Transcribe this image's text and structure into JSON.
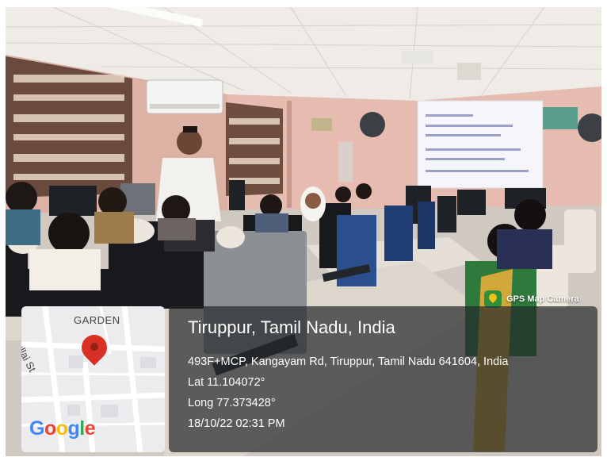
{
  "camera_badge": {
    "label": "GPS Map Camera",
    "icon": "gps-map-camera-icon"
  },
  "map": {
    "area_label": "GARDEN",
    "street_label": "Mullai St",
    "logo_text": "Google",
    "pin_icon": "map-pin-icon"
  },
  "location": {
    "title": "Tiruppur, Tamil Nadu, India",
    "address": "493F+MCP, Kangayam Rd, Tiruppur, Tamil Nadu 641604, India",
    "latitude": "Lat 11.104072°",
    "longitude": "Long 77.373428°",
    "timestamp": "18/10/22 02:31 PM"
  },
  "colors": {
    "wall": "#e4b9ad",
    "ceiling": "#efeae4",
    "pin": "#d93025",
    "overlay": "#23282a",
    "google_blue": "#4285f4",
    "google_red": "#ea4335",
    "google_yellow": "#fbbc05",
    "google_green": "#34a853"
  }
}
